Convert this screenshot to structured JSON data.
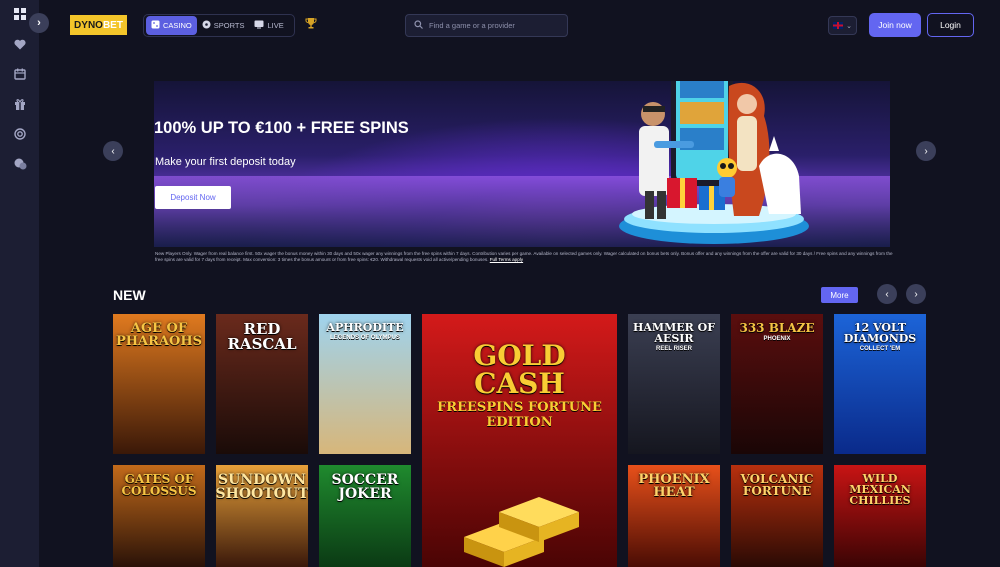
{
  "brand": {
    "part1": "DYNO",
    "part2": "BET"
  },
  "nav": {
    "tabs": [
      {
        "label": "CASINO",
        "icon": "casino-icon",
        "active": true
      },
      {
        "label": "SPORTS",
        "icon": "soccer-ball-icon",
        "active": false
      },
      {
        "label": "LIVE",
        "icon": "live-icon",
        "active": false
      }
    ],
    "trophy_icon": "trophy-icon"
  },
  "search": {
    "placeholder": "Find a game or a provider"
  },
  "language": {
    "selected": "EN",
    "icon": "uk-flag-icon"
  },
  "auth": {
    "join_label": "Join now",
    "login_label": "Login"
  },
  "sidebar": {
    "icons": [
      "grid-icon",
      "heart-icon",
      "calendar-icon",
      "gift-icon",
      "target-icon",
      "chat-icon"
    ]
  },
  "banner": {
    "title": "100% UP TO €100 + FREE SPINS",
    "subtitle": "Make your first deposit today",
    "button_label": "Deposit Now",
    "disclaimer": "New Players Only. Wager from real balance first. 50x wager the bonus money within 30 days and 50x wager any winnings from the free spins within 7 days. Contribution varies per game. Available on selected games only. Wager calculated on bonus bets only. Bonus offer and any winnings from the offer are valid for 30 days / Free spins and any winnings from the free spins are valid for 7 days from receipt. Max conversion: 3 times the bonus amount or from free spins: €20. Withdrawal requests void all active/pending bonuses.",
    "full_terms_label": "Full Terms apply"
  },
  "new_section": {
    "title": "NEW",
    "more_label": "More",
    "games": [
      {
        "name": "AGE OF PHARAOHS",
        "subtitle": "",
        "color_top": "#e07a1f",
        "color_bottom": "#3a1808",
        "text_color": "#f6c544"
      },
      {
        "name": "RED RASCAL",
        "subtitle": "",
        "color_top": "#6a2a1c",
        "color_bottom": "#1a0b08",
        "text_color": "#ffffff"
      },
      {
        "name": "APHRODITE",
        "subtitle": "LEGENDS OF OLYMPUS",
        "color_top": "#9fd3ee",
        "color_bottom": "#d7b67a",
        "text_color": "#ffffff"
      },
      {
        "name": "GOLD CASH",
        "subtitle": "FREESPINS FORTUNE EDITION",
        "color_top": "#d41a1a",
        "color_bottom": "#4a0404",
        "text_color": "#f9cd34"
      },
      {
        "name": "HAMMER OF AESIR",
        "subtitle": "REEL RISER",
        "color_top": "#3b3f52",
        "color_bottom": "#15161f",
        "text_color": "#ffffff"
      },
      {
        "name": "333 BLAZE",
        "subtitle": "PHOENIX",
        "color_top": "#5a0e0e",
        "color_bottom": "#1a0606",
        "text_color": "#f6c544"
      },
      {
        "name": "12 VOLT DIAMONDS",
        "subtitle": "COLLECT 'EM",
        "color_top": "#1c64d8",
        "color_bottom": "#0a2a8a",
        "text_color": "#ffffff"
      },
      {
        "name": "GATES OF COLOSSUS",
        "subtitle": "",
        "color_top": "#c26a1a",
        "color_bottom": "#2a1208",
        "text_color": "#f6c544"
      },
      {
        "name": "SUNDOWN SHOOTOUT",
        "subtitle": "",
        "color_top": "#e8a13a",
        "color_bottom": "#3a180a",
        "text_color": "#ffe7a0"
      },
      {
        "name": "SOCCER JOKER",
        "subtitle": "",
        "color_top": "#1f8a2e",
        "color_bottom": "#0b3a14",
        "text_color": "#ffffff"
      },
      {
        "name": "PHOENIX HEAT",
        "subtitle": "",
        "color_top": "#e8501a",
        "color_bottom": "#4a0c04",
        "text_color": "#ffd36a"
      },
      {
        "name": "VOLCANIC FORTUNE",
        "subtitle": "",
        "color_top": "#b8300e",
        "color_bottom": "#2a0a04",
        "text_color": "#ffd36a"
      },
      {
        "name": "WILD MEXICAN CHILLIES",
        "subtitle": "",
        "color_top": "#c81414",
        "color_bottom": "#3a0404",
        "text_color": "#ffd36a"
      }
    ]
  },
  "colors": {
    "accent": "#6366f1",
    "background": "#111220",
    "rail": "#1c1e33"
  }
}
